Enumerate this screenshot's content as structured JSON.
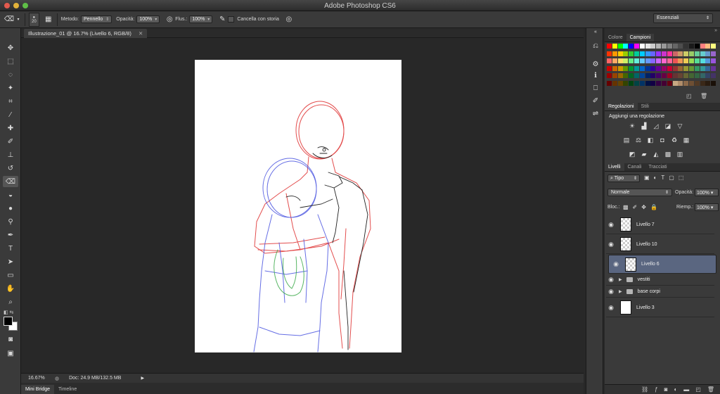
{
  "window": {
    "title": "Adobe Photoshop CS6",
    "workspace": "Essenziali"
  },
  "options": {
    "brush_size": "20",
    "mode_label": "Metodo:",
    "mode_value": "Pennello",
    "opacity_label": "Opacità:",
    "opacity_value": "100%",
    "flow_label": "Flus.:",
    "flow_value": "100%",
    "erase_history_label": "Cancella con storia"
  },
  "document": {
    "tab_title": "Illustrazione_01 @ 16.7% (Livello 6, RGB/8)"
  },
  "status": {
    "zoom": "16.67%",
    "doc_size": "Doc: 24.9 MB/132.5 MB"
  },
  "bottom_tabs": [
    "Mini Bridge",
    "Timeline"
  ],
  "panels": {
    "color_tabs": [
      "Colore",
      "Campioni"
    ],
    "adjust_tabs": [
      "Regolazioni",
      "Stili"
    ],
    "adjust_heading": "Aggiungi una regolazione",
    "layer_tabs": [
      "Livelli",
      "Canali",
      "Tracciati"
    ],
    "filter_type": "Tipo",
    "blend_mode": "Normale",
    "opacity_label": "Opacità:",
    "opacity_value": "100%",
    "lock_label": "Bloc.:",
    "fill_label": "Riemp.:",
    "fill_value": "100%"
  },
  "layers": [
    {
      "name": "Livello 7",
      "kind": "layer",
      "selected": false
    },
    {
      "name": "Livello 10",
      "kind": "layer",
      "selected": false
    },
    {
      "name": "Livello 6",
      "kind": "layer",
      "selected": true
    },
    {
      "name": "vestiti",
      "kind": "group",
      "selected": false
    },
    {
      "name": "base corpi",
      "kind": "group",
      "selected": false
    },
    {
      "name": "Livello 3",
      "kind": "layer",
      "selected": false
    }
  ],
  "colors": {
    "selected_layer": "#5a6680",
    "sketch_red": "#e03a3a",
    "sketch_blue": "#4a54e0",
    "sketch_green": "#3caa4a",
    "sketch_black": "#222222"
  }
}
